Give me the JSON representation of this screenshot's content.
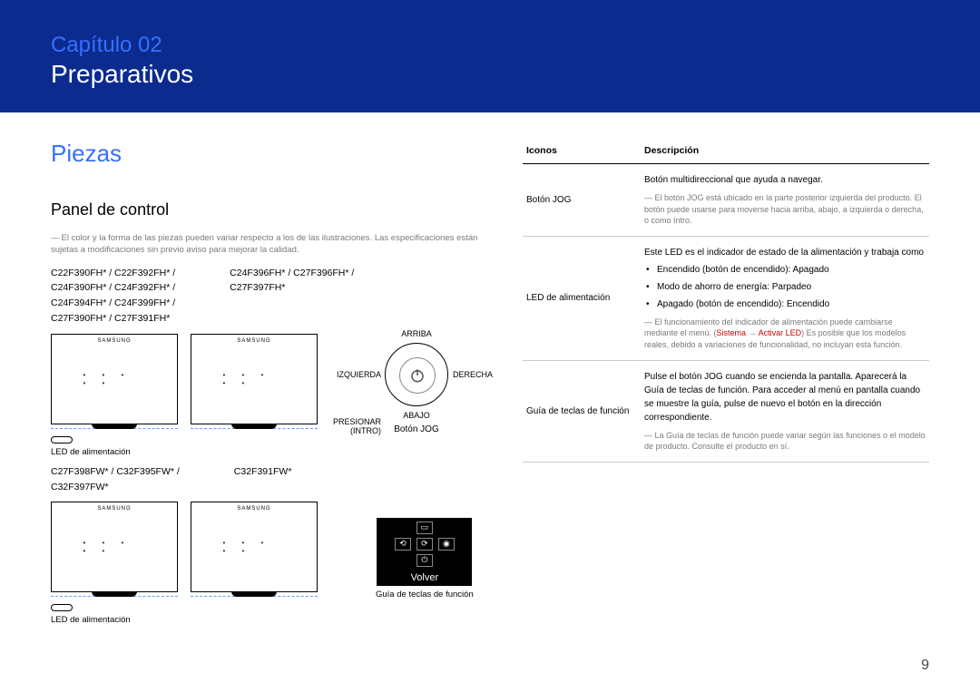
{
  "chapter": {
    "label": "Capítulo 02",
    "title": "Preparativos"
  },
  "section": "Piezas",
  "subsection": "Panel de control",
  "note1": "El color y la forma de las piezas pueden variar respecto a los de las ilustraciones. Las especificaciones están sujetas a modificaciones sin previo aviso para mejorar la calidad.",
  "models_group1": [
    "C22F390FH* / C22F392FH* /",
    "C24F390FH* / C24F392FH* /",
    "C24F394FH* / C24F399FH* /",
    "C27F390FH* / C27F391FH*"
  ],
  "models_group1b": [
    "C24F396FH* / C27F396FH* /",
    "C27F397FH*"
  ],
  "led_label": "LED de alimentación",
  "models_group2": [
    "C27F398FW* / C32F395FW* /",
    "C32F397FW*"
  ],
  "models_group2b": "C32F391FW*",
  "jog": {
    "up": "ARRIBA",
    "down": "ABAJO",
    "left": "IZQUIERDA",
    "right": "DERECHA",
    "press1": "PRESIONAR",
    "press2": "(INTRO)",
    "name": "Botón JOG"
  },
  "funcpanel": {
    "return": "Volver",
    "label": "Guía de teclas de función"
  },
  "table": {
    "h1": "Iconos",
    "h2": "Descripción",
    "r1k": "Botón JOG",
    "r1d": "Botón multidireccional que ayuda a navegar.",
    "r1n": "El botón JOG está ubicado en la parte posterior izquierda del producto. El botón puede usarse para moverse hacia arriba, abajo, a izquierda o derecha, o como Intro.",
    "r2k": "LED de alimentación",
    "r2d": "Este LED es el indicador de estado de la alimentación y trabaja como",
    "r2b1": "Encendido (botón de encendido): Apagado",
    "r2b2": "Modo de ahorro de energía: Parpadeo",
    "r2b3": "Apagado (botón de encendido): Encendido",
    "r2n1": "El funcionamiento del indicador de alimentación puede cambiarse mediante el menú. (",
    "r2n_red1": "Sistema",
    "r2n_arrow": " → ",
    "r2n_red2": "Activar LED",
    "r2n2": ") Es posible que los modelos reales, debido a variaciones de funcionalidad, no incluyan esta función.",
    "r3k": "Guía de teclas de función",
    "r3d": "Pulse el botón JOG cuando se encienda la pantalla. Aparecerá la Guía de teclas de función. Para acceder al menú en pantalla cuando se muestre la guía, pulse de nuevo el botón en la dirección correspondiente.",
    "r3n": "La Guía de teclas de función puede variar según las funciones o el modelo de producto. Consulte el producto en sí."
  },
  "page": "9"
}
